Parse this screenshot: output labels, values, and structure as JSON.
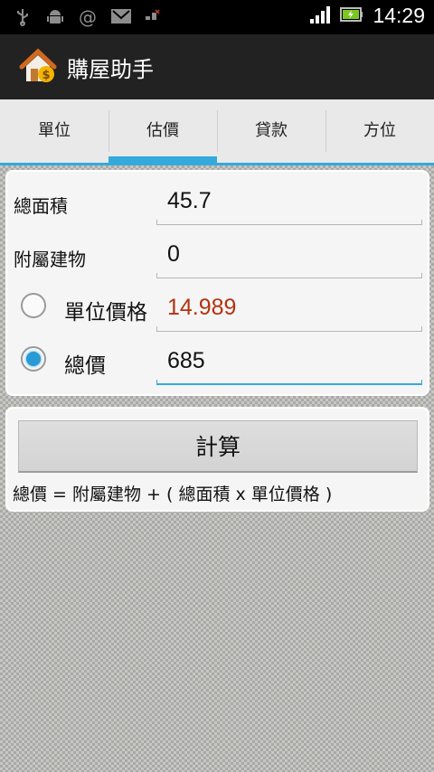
{
  "status_bar": {
    "icons": [
      "usb-icon",
      "android-debug-icon",
      "at-sign-icon",
      "gmail-icon",
      "signal-disconnected-icon"
    ],
    "time": "14:29",
    "colors": {
      "signal": "#ffffff",
      "battery": "#7cc620"
    }
  },
  "action_bar": {
    "title": "購屋助手",
    "icon": "house-dollar-icon"
  },
  "tabs": [
    {
      "label": "單位"
    },
    {
      "label": "估價",
      "selected": true
    },
    {
      "label": "貸款"
    },
    {
      "label": "方位"
    }
  ],
  "form": {
    "total_area": {
      "label": "總面積",
      "value": "45.7"
    },
    "auxiliary_building": {
      "label": "附屬建物",
      "value": "0"
    },
    "unit_price": {
      "label": "單位價格",
      "value": "14.989",
      "selected": false
    },
    "total_price": {
      "label": "總價",
      "value": "685",
      "selected": true
    }
  },
  "calculate_button": "計算",
  "formula": "總價 = 附屬建物 + ( 總面積 x 單位價格 )",
  "colors": {
    "accent": "#33a9dc",
    "calculated_value": "#b5320f"
  }
}
